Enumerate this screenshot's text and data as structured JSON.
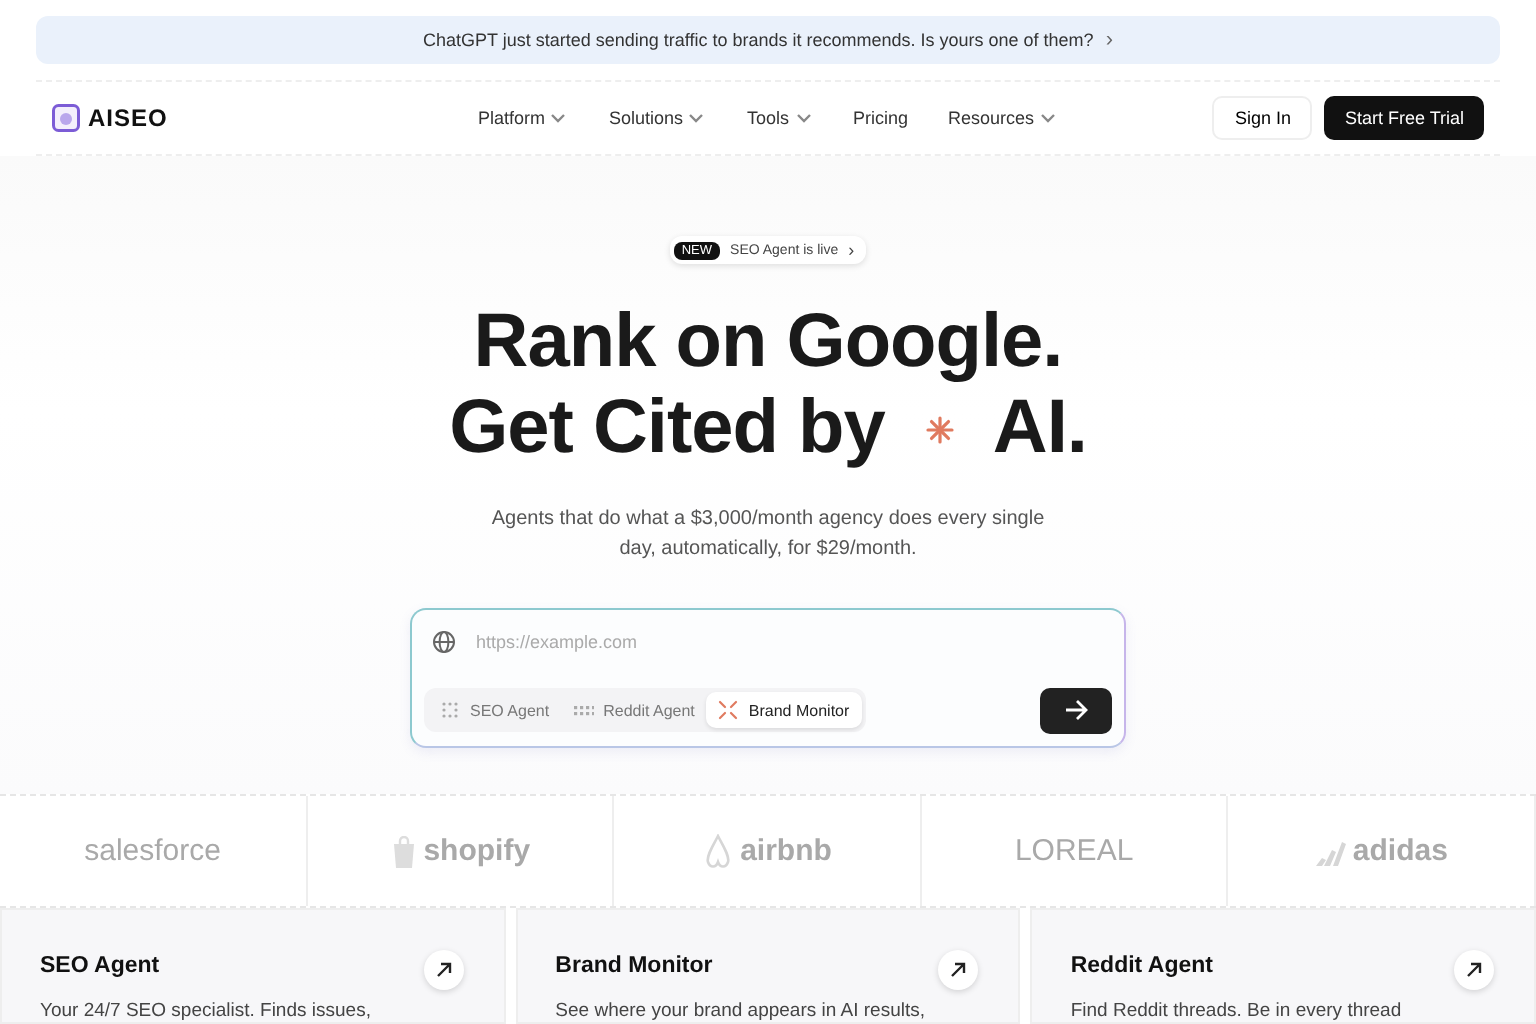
{
  "banner": {
    "text": "ChatGPT just started sending traffic to brands it recommends. Is yours one of them?",
    "arrow": "›"
  },
  "nav": {
    "logo": "AISEO",
    "items": [
      {
        "label": "Platform",
        "dropdown": true
      },
      {
        "label": "Solutions",
        "dropdown": true
      },
      {
        "label": "Tools",
        "dropdown": true
      },
      {
        "label": "Pricing",
        "dropdown": false
      },
      {
        "label": "Resources",
        "dropdown": true
      }
    ],
    "sign_in": "Sign In",
    "cta": "Start Free Trial"
  },
  "hero": {
    "badge_tag": "NEW",
    "badge_text": "SEO Agent is live",
    "badge_arrow": "›",
    "line_1": "Rank on Google.",
    "line_2_start": "Get Cited by",
    "line_2_end": "AI.",
    "subtitle": "Agents that do what a $3,000/month agency does every single day, automatically, for $29/month."
  },
  "search": {
    "placeholder": "https://example.com",
    "agents": [
      {
        "label": "SEO Agent",
        "selected": false
      },
      {
        "label": "Reddit Agent",
        "selected": false
      },
      {
        "label": "Brand Monitor",
        "selected": true
      }
    ]
  },
  "logos": [
    {
      "text": "salesforce",
      "kind": "plain"
    },
    {
      "text": "shopify",
      "kind": "bag"
    },
    {
      "text": "airbnb",
      "kind": "loop"
    },
    {
      "text": "LOREAL",
      "kind": "plain"
    },
    {
      "text": "adidas",
      "kind": "stripes"
    }
  ],
  "cards": [
    {
      "title": "SEO Agent",
      "text": "Your 24/7 SEO specialist. Finds issues,"
    },
    {
      "title": "Brand Monitor",
      "text": "See where your brand appears in AI results,"
    },
    {
      "title": "Reddit Agent",
      "text": "Find Reddit threads. Be in every thread"
    }
  ]
}
